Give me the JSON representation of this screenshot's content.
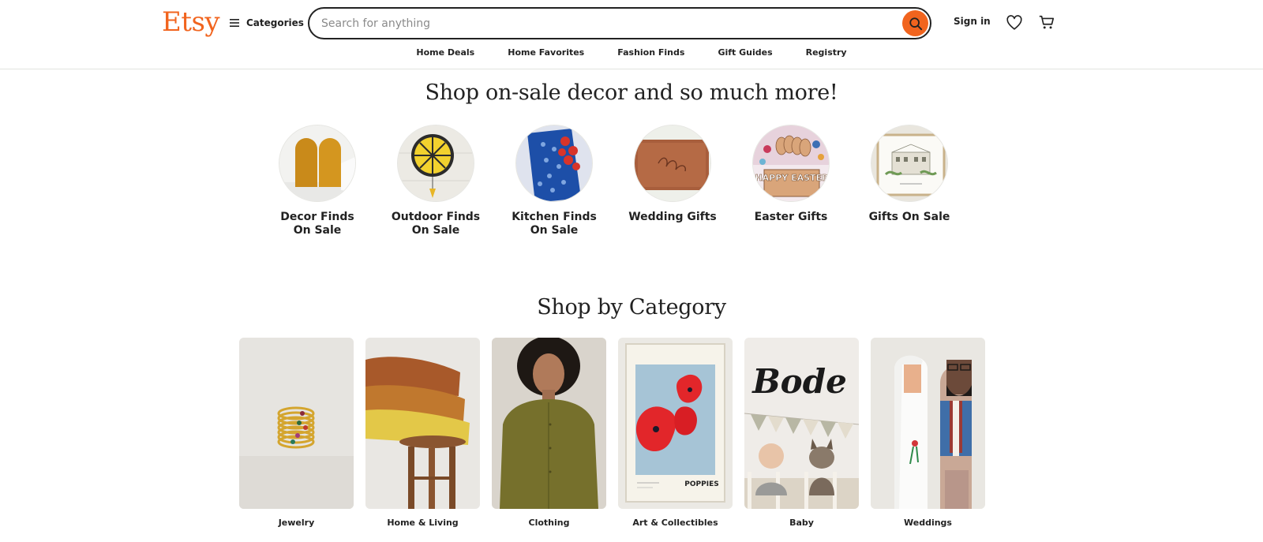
{
  "brand": {
    "logo_text": "Etsy",
    "accent_color": "#f1641e"
  },
  "header": {
    "categories_label": "Categories",
    "search_placeholder": "Search for anything",
    "search_value": "",
    "sign_in_label": "Sign in",
    "icons": {
      "menu": "hamburger-icon",
      "search": "search-icon",
      "favorites": "heart-icon",
      "cart": "cart-icon"
    }
  },
  "subnav": {
    "items": [
      {
        "label": "Home Deals"
      },
      {
        "label": "Home Favorites"
      },
      {
        "label": "Fashion Finds"
      },
      {
        "label": "Gift Guides"
      },
      {
        "label": "Registry"
      }
    ]
  },
  "promo": {
    "heading": "Shop on-sale decor and so much more!",
    "items": [
      {
        "label": "Decor Finds\nOn Sale"
      },
      {
        "label": "Outdoor Finds\nOn Sale"
      },
      {
        "label": "Kitchen Finds\nOn Sale"
      },
      {
        "label": "Wedding Gifts"
      },
      {
        "label": "Easter Gifts"
      },
      {
        "label": "Gifts On Sale"
      }
    ]
  },
  "categories": {
    "heading": "Shop by Category",
    "items": [
      {
        "label": "Jewelry"
      },
      {
        "label": "Home & Living"
      },
      {
        "label": "Clothing"
      },
      {
        "label": "Art & Collectibles"
      },
      {
        "label": "Baby"
      },
      {
        "label": "Weddings"
      }
    ]
  },
  "image_text": {
    "easter_sign": "HAPPY EASTER",
    "poster_caption": "POPPIES",
    "name_sign": "Bode"
  }
}
